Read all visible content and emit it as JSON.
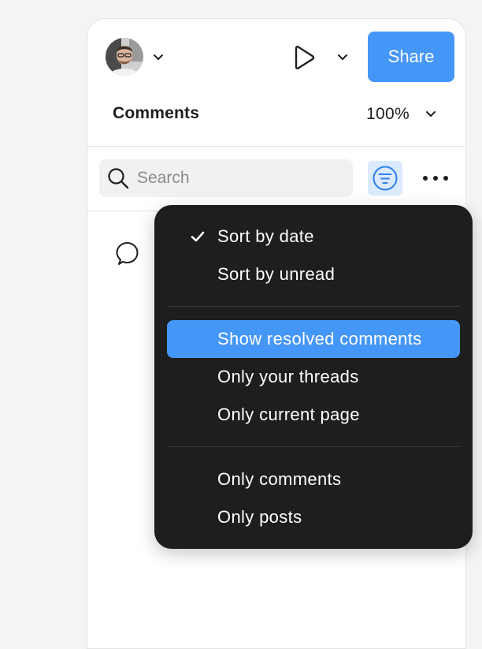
{
  "toolbar": {
    "avatar_icon": "user-avatar",
    "play_icon": "play-icon",
    "share_label": "Share"
  },
  "comments_header": {
    "title": "Comments",
    "zoom": "100%"
  },
  "search": {
    "placeholder": "Search",
    "value": ""
  },
  "icons": {
    "search": "search-icon",
    "filter": "filter-icon",
    "more": "more-icon",
    "comment": "comment-bubble-icon",
    "check": "checkmark-icon",
    "chevron": "chevron-down-icon"
  },
  "colors": {
    "accent": "#4597f7",
    "filter_button_bg": "#dbeafd",
    "menu_bg": "#1e1e1e",
    "panel_bg": "#ffffff"
  },
  "filter_menu": {
    "groups": [
      {
        "items": [
          {
            "label": "Sort by date",
            "checked": true
          },
          {
            "label": "Sort by unread",
            "checked": false
          }
        ]
      },
      {
        "items": [
          {
            "label": "Show resolved comments",
            "highlighted": true
          },
          {
            "label": "Only your threads"
          },
          {
            "label": "Only current page"
          }
        ]
      },
      {
        "items": [
          {
            "label": "Only comments"
          },
          {
            "label": "Only posts"
          }
        ]
      }
    ]
  }
}
